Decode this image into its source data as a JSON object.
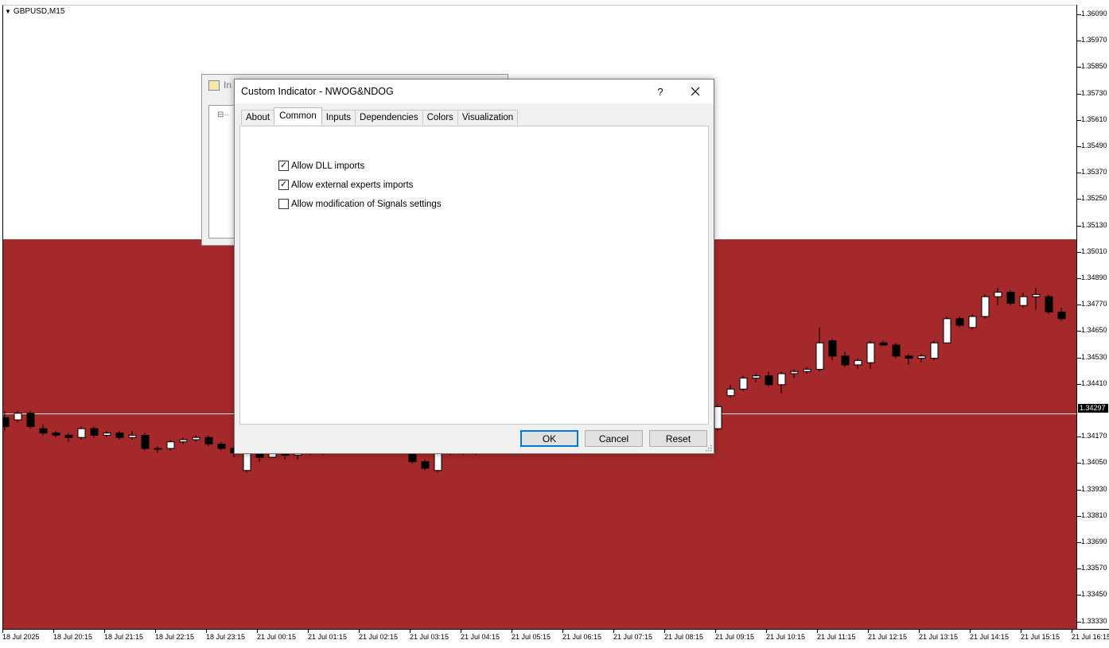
{
  "chart": {
    "symbol": "GBPUSD,M15",
    "colors": {
      "zone_red": "#a5292a",
      "bull_candle": "#ffffff",
      "bear_candle": "#000000",
      "price_line": "#e6e6e6"
    },
    "price_axis": {
      "labels": [
        "1.36090",
        "1.35970",
        "1.35850",
        "1.35730",
        "1.35610",
        "1.35490",
        "1.35370",
        "1.35250",
        "1.35130",
        "1.35010",
        "1.34890",
        "1.34770",
        "1.34650",
        "1.34530",
        "1.34410",
        "1.34170",
        "1.34050",
        "1.33930",
        "1.33810",
        "1.33690",
        "1.33570",
        "1.33450",
        "1.33330"
      ],
      "current_price": "1.34297"
    },
    "time_axis": {
      "labels": [
        "18 Jul 2025",
        "18 Jul 20:15",
        "18 Jul 21:15",
        "18 Jul 22:15",
        "18 Jul 23:15",
        "21 Jul 00:15",
        "21 Jul 01:15",
        "21 Jul 02:15",
        "21 Jul 03:15",
        "21 Jul 04:15",
        "21 Jul 05:15",
        "21 Jul 06:15",
        "21 Jul 07:15",
        "21 Jul 08:15",
        "21 Jul 09:15",
        "21 Jul 10:15",
        "21 Jul 11:15",
        "21 Jul 12:15",
        "21 Jul 13:15",
        "21 Jul 14:15",
        "21 Jul 15:15",
        "21 Jul 16:15"
      ]
    },
    "candles": [
      [
        1.3426,
        1.3429,
        1.342,
        1.3422
      ],
      [
        1.3425,
        1.3429,
        1.3424,
        1.3428
      ],
      [
        1.3428,
        1.3429,
        1.3421,
        1.3422
      ],
      [
        1.3421,
        1.3423,
        1.3418,
        1.3419
      ],
      [
        1.3419,
        1.342,
        1.3417,
        1.3418
      ],
      [
        1.3418,
        1.3419,
        1.3415,
        1.3417
      ],
      [
        1.3417,
        1.3422,
        1.3416,
        1.3421
      ],
      [
        1.3421,
        1.3422,
        1.3417,
        1.3418
      ],
      [
        1.3418,
        1.342,
        1.3417,
        1.3419
      ],
      [
        1.3419,
        1.342,
        1.3416,
        1.3417
      ],
      [
        1.3417,
        1.342,
        1.3416,
        1.3418
      ],
      [
        1.3418,
        1.3419,
        1.3411,
        1.3412
      ],
      [
        1.3412,
        1.3413,
        1.341,
        1.3412
      ],
      [
        1.3412,
        1.3416,
        1.3411,
        1.3415
      ],
      [
        1.3415,
        1.3417,
        1.3414,
        1.3416
      ],
      [
        1.3416,
        1.3418,
        1.3415,
        1.3417
      ],
      [
        1.3417,
        1.3418,
        1.3413,
        1.3414
      ],
      [
        1.3414,
        1.3415,
        1.3411,
        1.3412
      ],
      [
        1.3412,
        1.3413,
        1.3408,
        1.341
      ],
      [
        1.3402,
        1.3412,
        1.3401,
        1.3411
      ],
      [
        1.3411,
        1.3412,
        1.3406,
        1.3408
      ],
      [
        1.3408,
        1.3412,
        1.3408,
        1.3411
      ],
      [
        1.3411,
        1.3412,
        1.3407,
        1.3409
      ],
      [
        1.3409,
        1.3412,
        1.3407,
        1.3411
      ],
      [
        1.3411,
        1.3412,
        1.3409,
        1.341
      ],
      [
        1.341,
        1.3412,
        1.3409,
        1.3411
      ],
      [
        1.3411,
        1.3412,
        1.341,
        1.3411
      ],
      [
        1.3411,
        1.3412,
        1.341,
        1.3411
      ],
      [
        1.3411,
        1.3412,
        1.341,
        1.3411
      ],
      [
        1.3411,
        1.3412,
        1.341,
        1.3411
      ],
      [
        1.3411,
        1.3412,
        1.341,
        1.3411
      ],
      [
        1.3411,
        1.3412,
        1.341,
        1.3411
      ],
      [
        1.3411,
        1.3412,
        1.3405,
        1.3406
      ],
      [
        1.3406,
        1.3407,
        1.3402,
        1.3403
      ],
      [
        1.3402,
        1.3412,
        1.3401,
        1.341
      ],
      [
        1.341,
        1.3412,
        1.3409,
        1.3411
      ],
      [
        1.3411,
        1.3412,
        1.3409,
        1.341
      ],
      [
        1.341,
        1.3412,
        1.3409,
        1.3411
      ],
      [
        1.3411,
        1.3412,
        1.341,
        1.3411
      ],
      [
        1.3411,
        1.3412,
        1.341,
        1.3411
      ],
      [
        1.3411,
        1.3412,
        1.341,
        1.3411
      ],
      [
        1.3411,
        1.3412,
        1.341,
        1.3411
      ],
      [
        1.3411,
        1.3412,
        1.341,
        1.3411
      ],
      [
        1.3411,
        1.3412,
        1.341,
        1.3411
      ],
      [
        1.3411,
        1.3412,
        1.341,
        1.3411
      ],
      [
        1.3411,
        1.3412,
        1.341,
        1.3411
      ],
      [
        1.3411,
        1.3412,
        1.341,
        1.3411
      ],
      [
        1.3411,
        1.3412,
        1.341,
        1.3411
      ],
      [
        1.3411,
        1.3412,
        1.341,
        1.3411
      ],
      [
        1.3411,
        1.3412,
        1.341,
        1.3411
      ],
      [
        1.3411,
        1.3412,
        1.341,
        1.3411
      ],
      [
        1.3411,
        1.3412,
        1.341,
        1.3411
      ],
      [
        1.3411,
        1.3412,
        1.341,
        1.3411
      ],
      [
        1.3411,
        1.3412,
        1.341,
        1.3411
      ],
      [
        1.3411,
        1.3412,
        1.341,
        1.3411
      ],
      [
        1.3411,
        1.3412,
        1.341,
        1.3411
      ],
      [
        1.3421,
        1.3432,
        1.342,
        1.3431
      ],
      [
        1.3436,
        1.3441,
        1.3435,
        1.3439
      ],
      [
        1.3439,
        1.3445,
        1.3438,
        1.3444
      ],
      [
        1.3444,
        1.3446,
        1.3442,
        1.3445
      ],
      [
        1.3445,
        1.3447,
        1.344,
        1.3441
      ],
      [
        1.3441,
        1.3447,
        1.3437,
        1.3446
      ],
      [
        1.3446,
        1.3448,
        1.3444,
        1.3447
      ],
      [
        1.3447,
        1.3449,
        1.3446,
        1.3448
      ],
      [
        1.3448,
        1.3467,
        1.3447,
        1.346
      ],
      [
        1.3461,
        1.3462,
        1.3452,
        1.3454
      ],
      [
        1.3454,
        1.3456,
        1.3449,
        1.345
      ],
      [
        1.345,
        1.3453,
        1.3448,
        1.3452
      ],
      [
        1.3451,
        1.3461,
        1.3448,
        1.346
      ],
      [
        1.346,
        1.3461,
        1.3459,
        1.3459
      ],
      [
        1.3459,
        1.346,
        1.3453,
        1.3454
      ],
      [
        1.3454,
        1.3455,
        1.345,
        1.3453
      ],
      [
        1.3453,
        1.3455,
        1.3451,
        1.3454
      ],
      [
        1.3453,
        1.3461,
        1.3452,
        1.346
      ],
      [
        1.346,
        1.3472,
        1.346,
        1.3471
      ],
      [
        1.3471,
        1.3472,
        1.3467,
        1.3468
      ],
      [
        1.3467,
        1.3473,
        1.3466,
        1.3472
      ],
      [
        1.3472,
        1.3482,
        1.3471,
        1.3481
      ],
      [
        1.3481,
        1.3485,
        1.3477,
        1.3483
      ],
      [
        1.3483,
        1.3484,
        1.3477,
        1.3478
      ],
      [
        1.3477,
        1.3483,
        1.3476,
        1.3481
      ],
      [
        1.3481,
        1.3485,
        1.3475,
        1.3482
      ],
      [
        1.3481,
        1.3482,
        1.3473,
        1.3474
      ],
      [
        1.3474,
        1.3476,
        1.347,
        1.3471
      ]
    ]
  },
  "bg_dialog": {
    "title": "In"
  },
  "dialog": {
    "title": "Custom Indicator - NWOG&NDOG",
    "help_label": "?",
    "tabs": [
      {
        "label": "About",
        "active": false
      },
      {
        "label": "Common",
        "active": true
      },
      {
        "label": "Inputs",
        "active": false
      },
      {
        "label": "Dependencies",
        "active": false
      },
      {
        "label": "Colors",
        "active": false
      },
      {
        "label": "Visualization",
        "active": false
      }
    ],
    "checkboxes": [
      {
        "label": "Allow DLL imports",
        "checked": true
      },
      {
        "label": "Allow external experts imports",
        "checked": true
      },
      {
        "label": "Allow modification of Signals settings",
        "checked": false
      }
    ],
    "buttons": {
      "ok": "OK",
      "cancel": "Cancel",
      "reset": "Reset"
    }
  }
}
